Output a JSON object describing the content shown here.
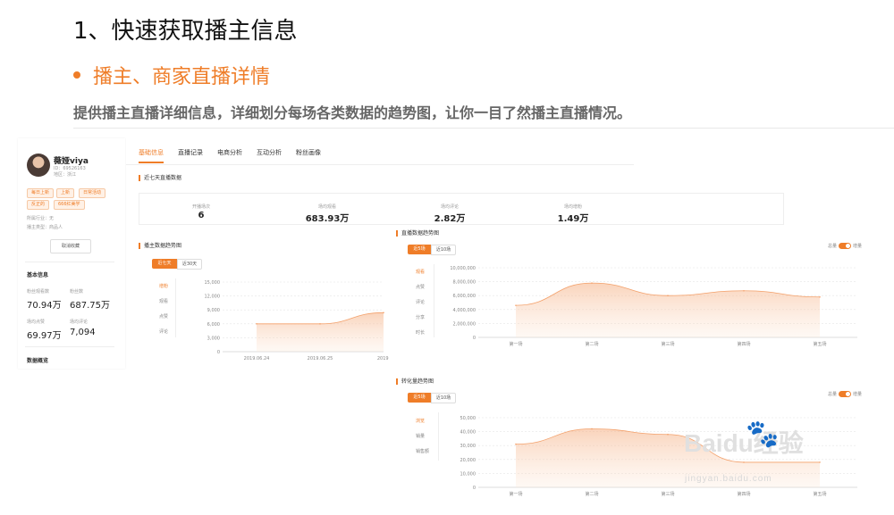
{
  "heading": "1、快速获取播主信息",
  "bullet": "播主、商家直播详情",
  "description": "提供播主直播详细信息，详细划分每场各类数据的趋势图，让你一目了然播主直播情况。",
  "profile": {
    "name": "薇娅viya",
    "id_line": "ID：69526163",
    "location": "地区：浙江",
    "tags": [
      "每日上新",
      "上新",
      "日常活动",
      "反正的",
      "666红美学"
    ],
    "industry": "所属行业：无",
    "type": "播主类型：商品人",
    "unfollow": "取消收藏",
    "basic_info_label": "基本信息",
    "stats": [
      {
        "label": "粉丝观看数",
        "value": "70.94万"
      },
      {
        "label": "粉丝数",
        "value": "687.75万"
      },
      {
        "label": "场均点赞",
        "value": "69.97万"
      },
      {
        "label": "场均评论",
        "value": "7,094"
      }
    ],
    "data_overview": "数据概览"
  },
  "tabs": [
    "基础信息",
    "直播记录",
    "电商分析",
    "互动分析",
    "粉丝画像"
  ],
  "recent7": {
    "title": "近七天直播数据",
    "items": [
      {
        "label": "开播场次",
        "value": "6"
      },
      {
        "label": "场均观看",
        "value": "683.93万"
      },
      {
        "label": "场均评论",
        "value": "2.82万"
      },
      {
        "label": "场均增粉",
        "value": "1.49万"
      }
    ]
  },
  "chart1": {
    "title": "播主数据趋势图",
    "btn_on": "近七天",
    "btn_off": "近30天",
    "side": [
      "增粉",
      "观看",
      "点赞",
      "评论"
    ],
    "yticks": [
      "15,000",
      "12,000",
      "9,000",
      "6,000",
      "3,000",
      "0"
    ],
    "xticks": [
      "2019.06.24",
      "2019.06.25",
      "2019."
    ]
  },
  "chart2": {
    "title": "直播数据趋势图",
    "btn_on": "近5场",
    "btn_off": "近10场",
    "toggle_left": "总量",
    "toggle_right": "增量",
    "side": [
      "观看",
      "点赞",
      "评论",
      "分享",
      "时长"
    ],
    "yticks": [
      "10,000,000",
      "8,000,000",
      "6,000,000",
      "4,000,000",
      "2,000,000",
      "0"
    ],
    "xticks": [
      "第一场",
      "第二场",
      "第三场",
      "第四场",
      "第五场"
    ]
  },
  "chart3": {
    "title": "转化量趋势图",
    "btn_on": "近5场",
    "btn_off": "近10场",
    "toggle_left": "总量",
    "toggle_right": "增量",
    "side": [
      "浏览",
      "销量",
      "销售额"
    ],
    "yticks": [
      "50,000",
      "40,000",
      "30,000",
      "20,000",
      "10,000",
      "0"
    ],
    "xticks": [
      "第一场",
      "第二场",
      "第三场",
      "第四场",
      "第五场"
    ]
  },
  "watermark": {
    "main": "Baidu经验",
    "sub": "jingyan.baidu.com"
  },
  "chart_data": [
    {
      "type": "area",
      "title": "播主数据趋势图",
      "x": [
        "2019.06.24",
        "2019.06.25",
        "2019."
      ],
      "series": [
        {
          "name": "增粉",
          "values": [
            6000,
            6000,
            8400
          ]
        }
      ],
      "ylim": [
        0,
        15000
      ]
    },
    {
      "type": "area",
      "title": "直播数据趋势图",
      "x": [
        "第一场",
        "第二场",
        "第三场",
        "第四场",
        "第五场"
      ],
      "series": [
        {
          "name": "观看",
          "values": [
            4600000,
            7800000,
            6000000,
            6700000,
            5800000
          ]
        }
      ],
      "ylim": [
        0,
        10000000
      ]
    },
    {
      "type": "area",
      "title": "转化量趋势图",
      "x": [
        "第一场",
        "第二场",
        "第三场",
        "第四场",
        "第五场"
      ],
      "series": [
        {
          "name": "浏览",
          "values": [
            31000,
            42000,
            38000,
            18000,
            18000
          ]
        }
      ],
      "ylim": [
        0,
        50000
      ]
    }
  ]
}
